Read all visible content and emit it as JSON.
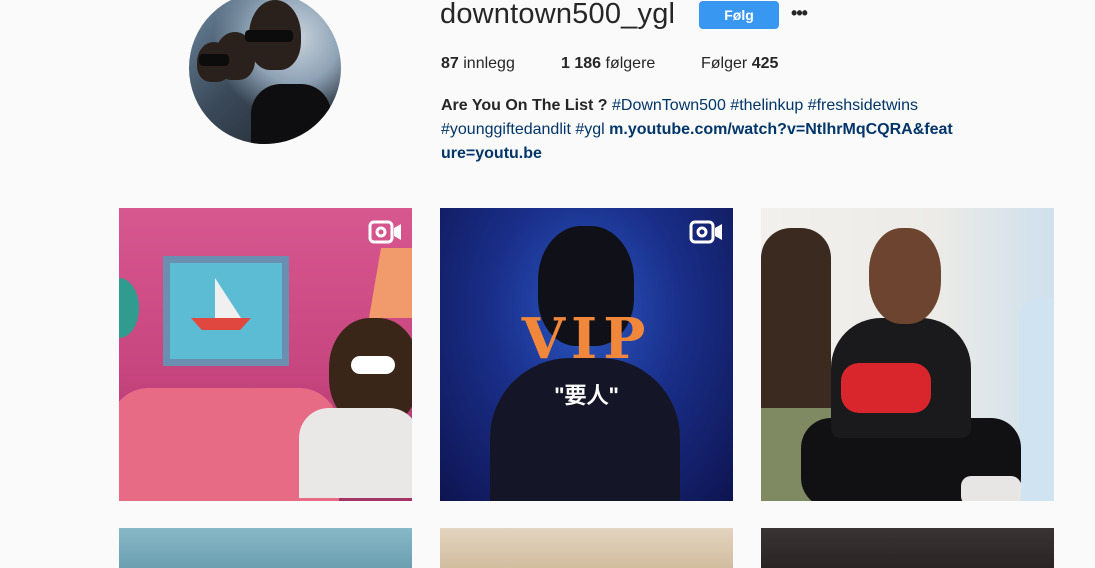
{
  "profile": {
    "username": "downtown500_ygl",
    "follow_label": "Følg",
    "more_label": "•••",
    "stats": {
      "posts_count": "87",
      "posts_label": "innlegg",
      "followers_count": "1 186",
      "followers_label": "følgere",
      "following_label": "Følger",
      "following_count": "425"
    },
    "bio": {
      "name": "Are You On The List ?",
      "hashtags": [
        "#DownTown500",
        "#thelinkup",
        "#freshsidetwins",
        "#younggiftedandlit",
        "#ygl"
      ],
      "link": "m.youtube.com/watch?v=NtlhrMqCQRA&feature=youtu.be"
    }
  },
  "posts": [
    {
      "type": "video",
      "icon": "video-camera-icon"
    },
    {
      "type": "video",
      "icon": "video-camera-icon",
      "title": "VIP",
      "subtitle": "\"要人\""
    },
    {
      "type": "photo"
    }
  ],
  "colors": {
    "follow_button": "#3897f0",
    "link": "#003569",
    "text": "#262626",
    "background": "#fafafa"
  }
}
